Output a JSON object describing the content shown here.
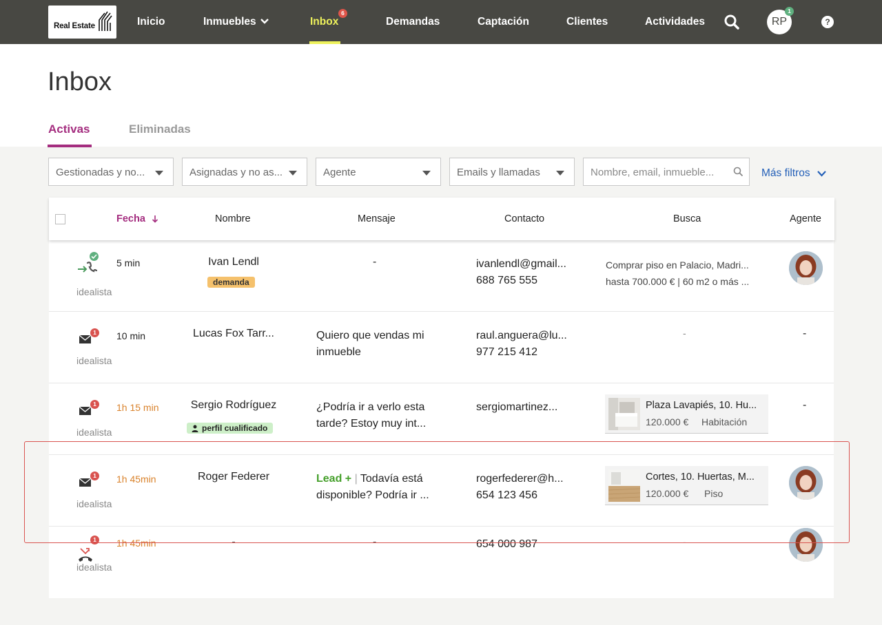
{
  "app": {
    "logo_text": "Real Estate",
    "accent": "#a42d7f",
    "nav_active_color": "#eef25c",
    "topbar_color": "#484843"
  },
  "nav": {
    "items": [
      {
        "label": "Inicio"
      },
      {
        "label": "Inmuebles"
      },
      {
        "label": "Inbox",
        "badge": "6"
      },
      {
        "label": "Demandas"
      },
      {
        "label": "Captación"
      },
      {
        "label": "Clientes"
      },
      {
        "label": "Actividades"
      }
    ],
    "user_initials": "RP",
    "user_badge": "1",
    "help_label": "?",
    "icons": [
      "chevron-down-icon",
      "search-icon",
      "help-icon"
    ]
  },
  "page": {
    "title": "Inbox",
    "tabs": [
      {
        "label": "Activas",
        "active": true
      },
      {
        "label": "Eliminadas",
        "active": false
      }
    ]
  },
  "filters": {
    "gestion": "Gestionadas y no...",
    "asignacion": "Asignadas y no as...",
    "agente": "Agente",
    "tipo": "Emails y llamadas",
    "search_placeholder": "Nombre, email, inmueble...",
    "more_filters": "Más filtros"
  },
  "table": {
    "headers": {
      "fecha": "Fecha",
      "nombre": "Nombre",
      "mensaje": "Mensaje",
      "contacto": "Contacto",
      "busca": "Busca",
      "agente": "Agente"
    },
    "rows": [
      {
        "channel_icon": "phone-incoming-icon",
        "badge": "",
        "source": "idealista",
        "time": "5 min",
        "name": "Ivan Lendl",
        "tag": "demanda",
        "message": "-",
        "email": "ivanlendl@gmail...",
        "phone": "688 765 555",
        "busca_line1": "Comprar piso en Palacio, Madri...",
        "busca_line2": "hasta 700.000 € | 60 m2 o más ...",
        "agent": "avatar"
      },
      {
        "channel_icon": "mail-icon",
        "badge": "1",
        "source": "idealista",
        "time": "10 min",
        "name": "Lucas Fox Tarr...",
        "message_line1": "Quiero que vendas mi",
        "message_line2": "inmueble",
        "email": "raul.anguera@lu...",
        "phone": "977 215 412",
        "busca": "-",
        "agent": "-"
      },
      {
        "channel_icon": "mail-icon",
        "badge": "1",
        "source": "idealista",
        "time": "1h 15 min",
        "name": "Sergio Rodríguez",
        "tag": "perfil cualificado",
        "message_line1": "¿Podría ir a verlo esta",
        "message_line2": "tarde? Estoy muy int...",
        "email": "sergiomartinez...",
        "property": {
          "title": "Plaza Lavapiés, 10. Hu...",
          "price": "120.000 €",
          "type": "Habitación"
        },
        "agent": "-"
      },
      {
        "channel_icon": "mail-icon",
        "badge": "1",
        "source": "idealista",
        "time": "1h 45min",
        "name": "Roger Federer",
        "lead_label": "Lead +",
        "lead_sep": "|",
        "message_line1": "Todavía está",
        "message_line2": "disponible? Podría ir ...",
        "email": "rogerfederer@h...",
        "phone": "654 123 456",
        "property": {
          "title": "Cortes, 10. Huertas, M...",
          "price": "120.000 €",
          "type": "Piso"
        },
        "agent": "avatar"
      },
      {
        "channel_icon": "missed-call-icon",
        "badge": "1",
        "source": "idealista",
        "time": "1h 45min",
        "name": "-",
        "message": "-",
        "phone": "654 000 987",
        "busca": "-",
        "agent": "avatar"
      }
    ]
  }
}
